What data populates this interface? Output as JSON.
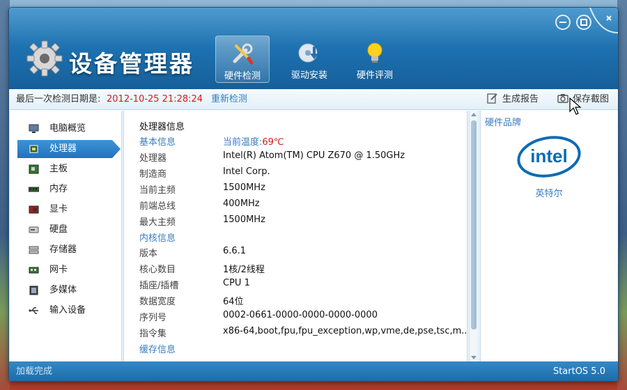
{
  "app": {
    "title": "设备管理器"
  },
  "toolbar": {
    "tabs": [
      {
        "label": "硬件检测",
        "icon": "wrench-screwdriver-icon",
        "active": true
      },
      {
        "label": "驱动安装",
        "icon": "cd-install-icon",
        "active": false
      },
      {
        "label": "硬件评测",
        "icon": "lightbulb-icon",
        "active": false
      }
    ]
  },
  "infobar": {
    "last_check_label": "最后一次检测日期是:",
    "last_check_date": "2012-10-25 21:28:24",
    "recheck_label": "重新检测",
    "report_label": "生成报告",
    "screenshot_label": "保存截图"
  },
  "sidebar": {
    "items": [
      {
        "label": "电脑概览",
        "icon": "computer-icon"
      },
      {
        "label": "处理器",
        "icon": "cpu-icon",
        "active": true
      },
      {
        "label": "主板",
        "icon": "motherboard-icon"
      },
      {
        "label": "内存",
        "icon": "memory-icon"
      },
      {
        "label": "显卡",
        "icon": "graphics-card-icon"
      },
      {
        "label": "硬盘",
        "icon": "harddisk-icon"
      },
      {
        "label": "存储器",
        "icon": "storage-icon"
      },
      {
        "label": "网卡",
        "icon": "network-card-icon"
      },
      {
        "label": "多媒体",
        "icon": "multimedia-icon"
      },
      {
        "label": "输入设备",
        "icon": "usb-icon"
      }
    ]
  },
  "cpu": {
    "title": "处理器信息",
    "basic_section": "基本信息",
    "temp_label": "当前温度:",
    "temp_value": "69℃",
    "rows_basic": [
      {
        "key": "处理器",
        "value": "Intel(R) Atom(TM) CPU Z670   @ 1.50GHz"
      },
      {
        "key": "制造商",
        "value": "Intel Corp."
      },
      {
        "key": "当前主频",
        "value": "1500MHz"
      },
      {
        "key": "前端总线",
        "value": "400MHz"
      },
      {
        "key": "最大主频",
        "value": "1500MHz"
      }
    ],
    "core_section": "内核信息",
    "rows_core": [
      {
        "key": "版本",
        "value": "6.6.1"
      },
      {
        "key": "核心数目",
        "value": "1核/2线程"
      },
      {
        "key": "插座/插槽",
        "value": "CPU 1"
      },
      {
        "key": "数据宽度",
        "value": "64位"
      },
      {
        "key": "序列号",
        "value": "0002-0661-0000-0000-0000-0000"
      },
      {
        "key": "指令集",
        "value": "x86-64,boot,fpu,fpu_exception,wp,vme,de,pse,tsc,m..."
      }
    ],
    "cache_section": "缓存信息"
  },
  "brand": {
    "title": "硬件品牌",
    "logo_text": "intel",
    "name": "英特尔"
  },
  "status": {
    "text": "加载完成",
    "version": "StartOS 5.0"
  },
  "colors": {
    "accent": "#1f73bf",
    "date_red": "#d21b1b",
    "link_blue": "#3a7cc0"
  }
}
